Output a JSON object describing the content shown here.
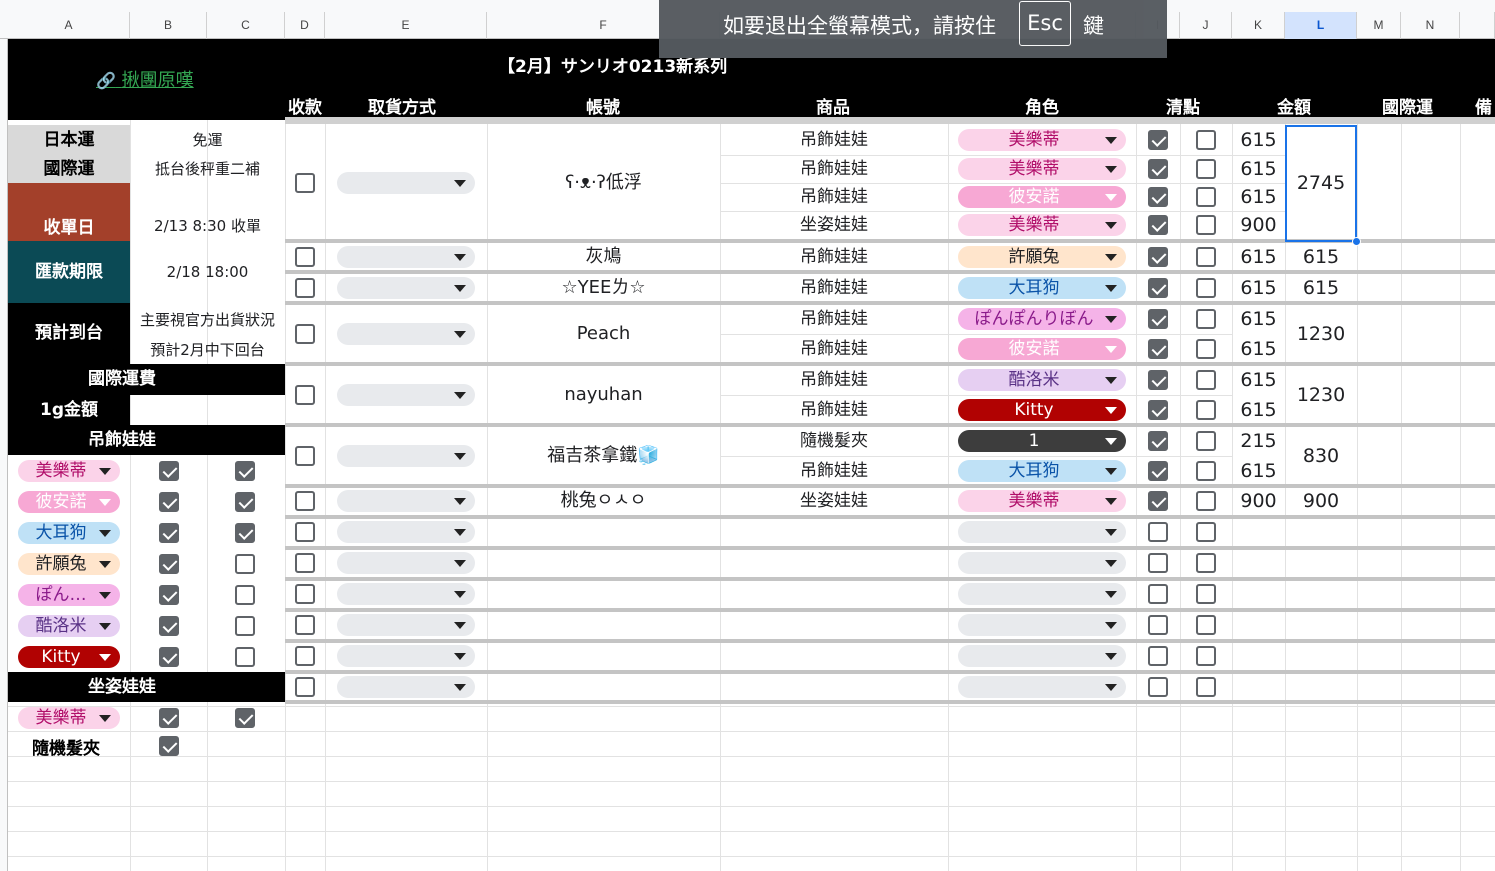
{
  "columns": [
    "A",
    "B",
    "C",
    "D",
    "E",
    "F",
    "G",
    "H",
    "I",
    "J",
    "K",
    "L",
    "M",
    "N"
  ],
  "selected_column": "L",
  "toast": {
    "before": "如要退出全螢幕模式，請按住",
    "key": "Esc",
    "after": "鍵"
  },
  "sheet_title": "【2月】サンリオ0213新系列",
  "link_label": "揪團原嘆",
  "headers": {
    "payment": "收款",
    "pickup": "取貨方式",
    "account": "帳號",
    "product": "商品",
    "character": "角色",
    "check": "清點",
    "amount": "金額",
    "intl": "國際運",
    "note": "備"
  },
  "info": [
    {
      "label": "日本運",
      "value": "免運"
    },
    {
      "label": "國際運",
      "value": "抵台後秤重二補"
    },
    {
      "label": "收單日",
      "value": "2/13 8:30 收單"
    },
    {
      "label": "匯款期限",
      "value": "2/18 18:00"
    },
    {
      "label": "預計到台",
      "value1": "主要視官方出貨狀況",
      "value2": "預計2月中下回台"
    },
    {
      "label": "國際運費"
    },
    {
      "label": "1g金額",
      "value": ""
    }
  ],
  "left_sections": [
    {
      "title": "吊飾娃娃",
      "items": [
        {
          "name": "美樂蒂",
          "bg": "#fbd3e9",
          "color": "#b10f6a",
          "b": true,
          "c": true
        },
        {
          "name": "彼安諾",
          "bg": "#f7a8d4",
          "color": "#ffffff",
          "b": true,
          "c": true
        },
        {
          "name": "大耳狗",
          "bg": "#bfe1f6",
          "color": "#0a53a8",
          "b": true,
          "c": true
        },
        {
          "name": "許願兔",
          "bg": "#ffe5cc",
          "color": "#202124",
          "b": true,
          "c": false
        },
        {
          "name": "ぽん…",
          "bg": "#f5b3e8",
          "color": "#8a1a8a",
          "b": true,
          "c": false
        },
        {
          "name": "酷洛米",
          "bg": "#e6cff2",
          "color": "#5a3286",
          "b": true,
          "c": false
        },
        {
          "name": "Kitty",
          "bg": "#b10202",
          "color": "#ffffff",
          "b": true,
          "c": false
        }
      ]
    },
    {
      "title": "坐姿娃娃",
      "items": [
        {
          "name": "美樂蒂",
          "bg": "#fbd3e9",
          "color": "#b10f6a",
          "b": true,
          "c": true
        },
        {
          "name": "隨機髮夾",
          "bg": "",
          "color": "#000000",
          "b": true,
          "c": null
        }
      ]
    }
  ],
  "orders": [
    {
      "account": "ʕ·ᴥ·ʔ低浮",
      "amount": "2745",
      "items": [
        {
          "product": "吊飾娃娃",
          "character": "美樂蒂",
          "bg": "#fbd3e9",
          "color": "#b10f6a",
          "checked": true,
          "counted": false,
          "price": "615"
        },
        {
          "product": "吊飾娃娃",
          "character": "美樂蒂",
          "bg": "#fbd3e9",
          "color": "#b10f6a",
          "checked": true,
          "counted": false,
          "price": "615"
        },
        {
          "product": "吊飾娃娃",
          "character": "彼安諾",
          "bg": "#f7a8d4",
          "color": "#ffffff",
          "checked": true,
          "counted": false,
          "price": "615"
        },
        {
          "product": "坐姿娃娃",
          "character": "美樂蒂",
          "bg": "#fbd3e9",
          "color": "#b10f6a",
          "checked": true,
          "counted": false,
          "price": "900"
        }
      ]
    },
    {
      "account": "灰鳩",
      "amount": "615",
      "items": [
        {
          "product": "吊飾娃娃",
          "character": "許願兔",
          "bg": "#ffe5cc",
          "color": "#202124",
          "checked": true,
          "counted": false,
          "price": "615"
        }
      ]
    },
    {
      "account": "☆YEEㄌ☆",
      "amount": "615",
      "items": [
        {
          "product": "吊飾娃娃",
          "character": "大耳狗",
          "bg": "#bfe1f6",
          "color": "#0a53a8",
          "checked": true,
          "counted": false,
          "price": "615"
        }
      ]
    },
    {
      "account": "Peach",
      "amount": "1230",
      "items": [
        {
          "product": "吊飾娃娃",
          "character": "ぽんぽんりぼん",
          "bg": "#f5b3e8",
          "color": "#8a1a8a",
          "checked": true,
          "counted": false,
          "price": "615"
        },
        {
          "product": "吊飾娃娃",
          "character": "彼安諾",
          "bg": "#f7a8d4",
          "color": "#ffffff",
          "checked": true,
          "counted": false,
          "price": "615"
        }
      ]
    },
    {
      "account": "nayuhan",
      "amount": "1230",
      "items": [
        {
          "product": "吊飾娃娃",
          "character": "酷洛米",
          "bg": "#e6cff2",
          "color": "#5a3286",
          "checked": true,
          "counted": false,
          "price": "615"
        },
        {
          "product": "吊飾娃娃",
          "character": "Kitty",
          "bg": "#b10202",
          "color": "#ffffff",
          "checked": true,
          "counted": false,
          "price": "615"
        }
      ]
    },
    {
      "account": "福吉茶拿鐵🧊",
      "amount": "830",
      "items": [
        {
          "product": "隨機髮夾",
          "character": "1",
          "bg": "#3d3d3d",
          "color": "#ffffff",
          "checked": true,
          "counted": false,
          "price": "215"
        },
        {
          "product": "吊飾娃娃",
          "character": "大耳狗",
          "bg": "#bfe1f6",
          "color": "#0a53a8",
          "checked": true,
          "counted": false,
          "price": "615"
        }
      ]
    },
    {
      "account": "桃兔ㅇㅅㅇ",
      "amount": "900",
      "items": [
        {
          "product": "坐姿娃娃",
          "character": "美樂蒂",
          "bg": "#fbd3e9",
          "color": "#b10f6a",
          "checked": true,
          "counted": false,
          "price": "900"
        }
      ]
    }
  ],
  "empty_rows": 6
}
